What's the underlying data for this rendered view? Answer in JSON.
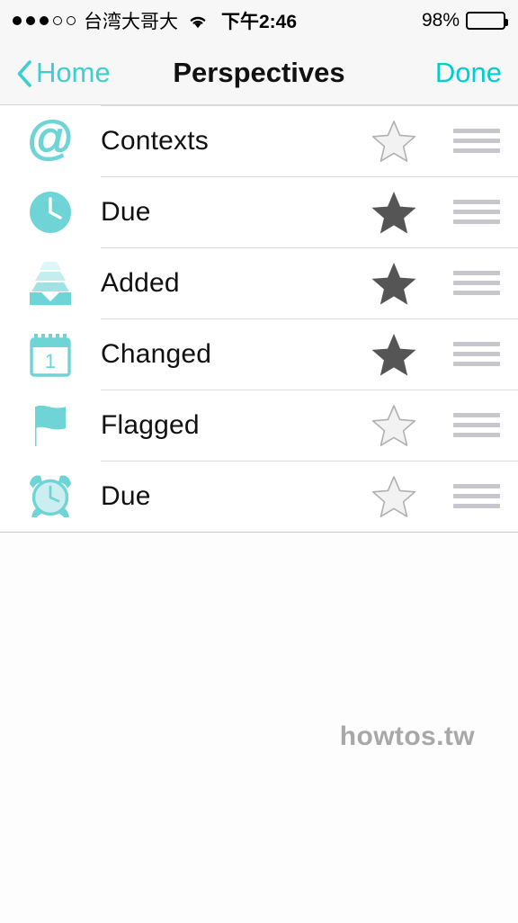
{
  "status_bar": {
    "signal_dots_filled": 3,
    "signal_dots_total": 5,
    "carrier": "台湾大哥大",
    "wifi_icon": "wifi-icon",
    "time": "下午2:46",
    "battery_percent": "98%",
    "battery_level": 96
  },
  "nav_bar": {
    "back_label": "Home",
    "back_icon": "chevron-left-icon",
    "title": "Perspectives",
    "done_label": "Done"
  },
  "colors": {
    "teal": "#6fd4d6",
    "teal_bright": "#00cdd1",
    "teal_link": "#3ecfd0",
    "star_filled": "#555555",
    "star_empty_fill": "#f2f2f2",
    "star_empty_stroke": "#b0b0b0",
    "handle": "#c6c6cc",
    "separator": "#dcdcdc"
  },
  "list": {
    "rows": [
      {
        "icon": "at-sign-icon",
        "label": "Contexts",
        "starred": false
      },
      {
        "icon": "clock-icon",
        "label": "Due",
        "starred": true
      },
      {
        "icon": "inbox-stack-icon",
        "label": "Added",
        "starred": true
      },
      {
        "icon": "calendar-icon",
        "label": "Changed",
        "starred": true,
        "calendar_day": "1"
      },
      {
        "icon": "flag-icon",
        "label": "Flagged",
        "starred": false
      },
      {
        "icon": "alarm-clock-icon",
        "label": "Due",
        "starred": false
      }
    ]
  },
  "watermark": {
    "text": "howtos.tw"
  }
}
